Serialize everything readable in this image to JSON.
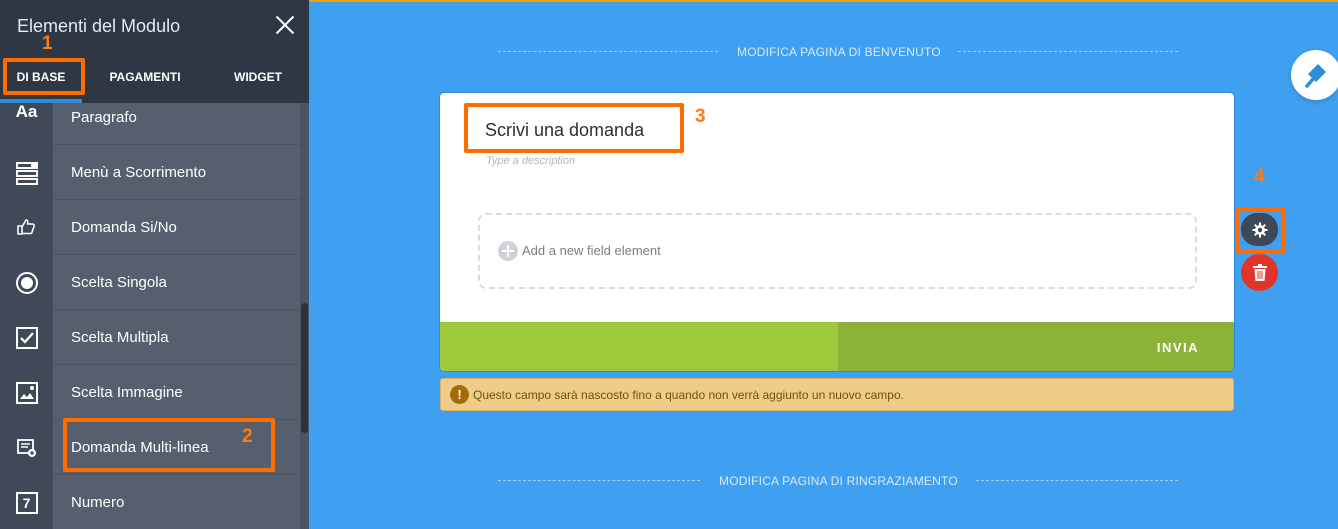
{
  "sidebar": {
    "title": "Elementi del Modulo",
    "tabs": [
      {
        "label": "DI BASE"
      },
      {
        "label": "PAGAMENTI"
      },
      {
        "label": "WIDGET"
      }
    ],
    "items": [
      {
        "label": "Paragrafo",
        "icon": "text-aa-icon"
      },
      {
        "label": "Menù a Scorrimento",
        "icon": "dropdown-icon"
      },
      {
        "label": "Domanda Si/No",
        "icon": "thumbs-icon"
      },
      {
        "label": "Scelta Singola",
        "icon": "radio-icon"
      },
      {
        "label": "Scelta Multipla",
        "icon": "checkbox-icon"
      },
      {
        "label": "Scelta Immagine",
        "icon": "image-choice-icon"
      },
      {
        "label": "Domanda Multi-linea",
        "icon": "multiline-icon"
      },
      {
        "label": "Numero",
        "icon": "number-icon"
      }
    ],
    "aa_glyph": "Aa",
    "number_glyph": "7"
  },
  "annotations": {
    "n1": "1",
    "n2": "2",
    "n3": "3",
    "n4": "4",
    "color": "#ff6d00"
  },
  "main": {
    "welcome_label": "MODIFICA PAGINA DI BENVENUTO",
    "thanks_label": "MODIFICA PAGINA DI RINGRAZIAMENTO",
    "question_title": "Scrivi una domanda",
    "question_description": "Type a description",
    "add_field_text": "Add a new field element",
    "submit_label": "INVIA",
    "warning_icon": "!",
    "warning_text": "Questo campo sarà nascosto fino a quando non verrà aggiunto un nuovo campo."
  },
  "colors": {
    "canvas_bg": "#3f9ff0",
    "sidebar_bg": "#555f6e",
    "header_bg": "#2f3744",
    "submit_green": "#9ec93b",
    "trash_red": "#e2342b",
    "warning_bg": "#efcc88"
  }
}
